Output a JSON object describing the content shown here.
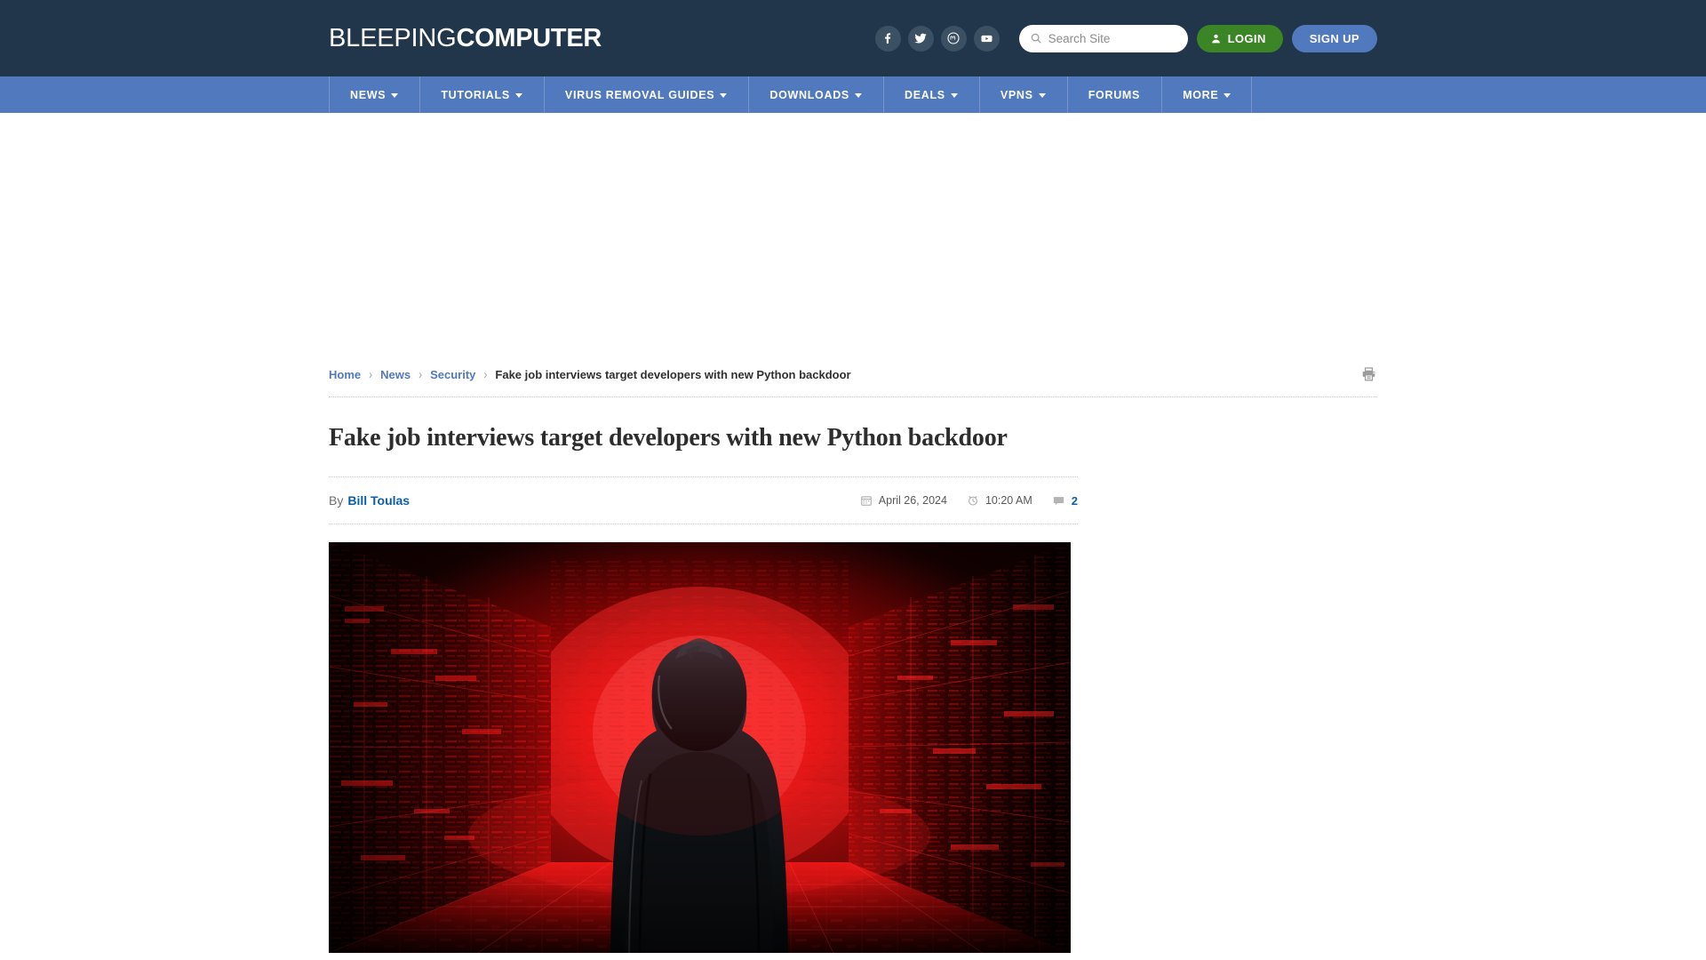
{
  "header": {
    "logo_light": "BLEEPING",
    "logo_bold": "COMPUTER",
    "social": [
      {
        "name": "facebook-icon",
        "label": "Facebook"
      },
      {
        "name": "twitter-icon",
        "label": "Twitter"
      },
      {
        "name": "mastodon-icon",
        "label": "Mastodon"
      },
      {
        "name": "youtube-icon",
        "label": "YouTube"
      }
    ],
    "search": {
      "placeholder": "Search Site",
      "value": "",
      "icon": "search-icon"
    },
    "login_label": "LOGIN",
    "signup_label": "SIGN UP",
    "colors": {
      "header_bg": "#21364b",
      "nav_bg": "#5179bd",
      "login_green": "#3c8527",
      "signup_blue": "#5179bd"
    }
  },
  "nav": {
    "items": [
      {
        "label": "NEWS",
        "has_caret": true
      },
      {
        "label": "TUTORIALS",
        "has_caret": true
      },
      {
        "label": "VIRUS REMOVAL GUIDES",
        "has_caret": true
      },
      {
        "label": "DOWNLOADS",
        "has_caret": true
      },
      {
        "label": "DEALS",
        "has_caret": true
      },
      {
        "label": "VPNS",
        "has_caret": true
      },
      {
        "label": "FORUMS",
        "has_caret": false
      },
      {
        "label": "MORE",
        "has_caret": true
      }
    ]
  },
  "breadcrumb": {
    "items": [
      {
        "label": "Home",
        "current": false
      },
      {
        "label": "News",
        "current": false
      },
      {
        "label": "Security",
        "current": false
      },
      {
        "label": "Fake job interviews target developers with new Python backdoor",
        "current": true
      }
    ],
    "separator": "›",
    "print_icon": "printer-icon"
  },
  "article": {
    "title": "Fake job interviews target developers with new Python backdoor",
    "by_label": "By",
    "author": "Bill Toulas",
    "date": "April 26, 2024",
    "time": "10:20 AM",
    "comment_count": "2",
    "icons": {
      "date": "calendar-icon",
      "time": "alarm-clock-icon",
      "comments": "comment-bubble-icon"
    },
    "hero_image_alt": "Hooded figure silhouette standing in a red digital data corridor"
  }
}
